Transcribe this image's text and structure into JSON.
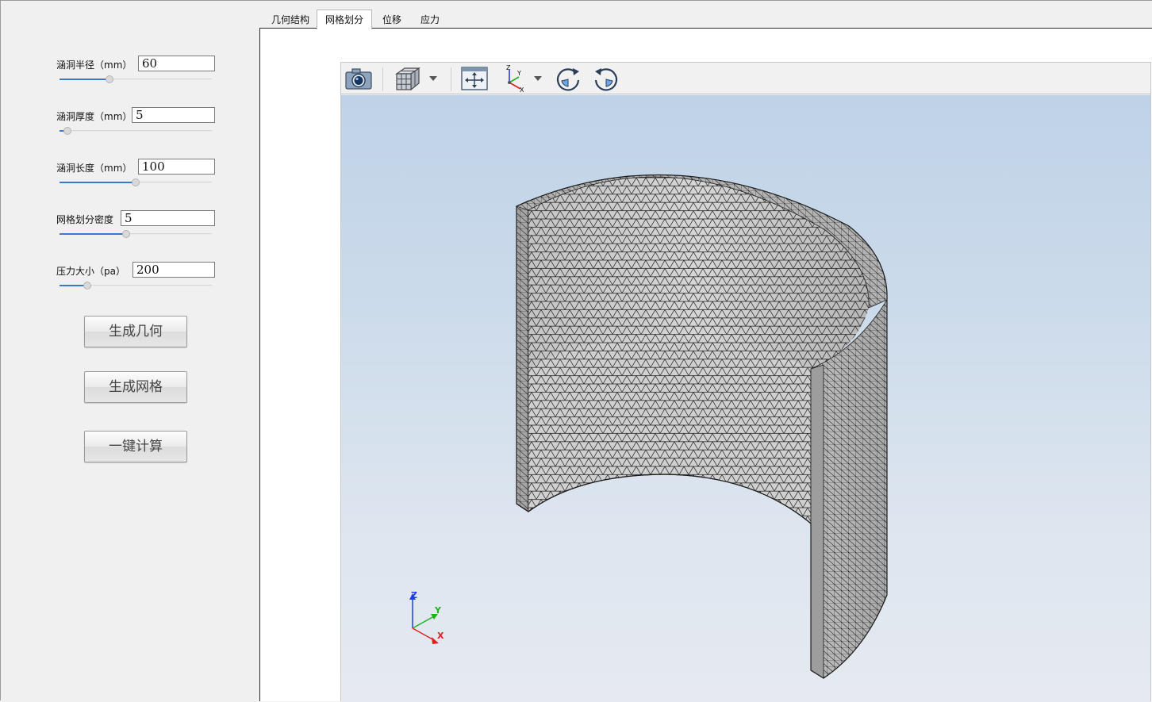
{
  "params": [
    {
      "label": "涵洞半径（mm）",
      "value": "60",
      "slider_fraction": 0.33
    },
    {
      "label": "涵洞厚度（mm）",
      "value": "5",
      "slider_fraction": 0.05
    },
    {
      "label": "涵洞长度（mm）",
      "value": "100",
      "slider_fraction": 0.5
    },
    {
      "label": "网格划分密度",
      "value": "5",
      "slider_fraction": 0.44
    },
    {
      "label": "压力大小（pa）",
      "value": "200",
      "slider_fraction": 0.18
    }
  ],
  "buttons": {
    "generate_geometry": "生成几何",
    "generate_mesh": "生成网格",
    "compute": "一键计算"
  },
  "tabs": [
    "几何结构",
    "网格划分",
    "位移",
    "应力"
  ],
  "active_tab": "网格划分",
  "toolbar": {
    "icons": [
      "camera-icon",
      "view-cube-icon",
      "chevron-down-icon",
      "fit-all-icon",
      "axes-view-icon",
      "chevron-down-icon",
      "rotate-cw-icon",
      "rotate-ccw-icon"
    ]
  },
  "axes": {
    "x": "X",
    "y": "Y",
    "z": "Z"
  },
  "colors": {
    "accent": "#3a79c6",
    "mesh_face": "#c9c9c9",
    "mesh_line": "#1e1e1e",
    "viewport_top": "#bfd2e7",
    "viewport_bottom": "#e6eaf0",
    "axis_x": "#e02020",
    "axis_y": "#22b022",
    "axis_z": "#1f3fe0"
  }
}
